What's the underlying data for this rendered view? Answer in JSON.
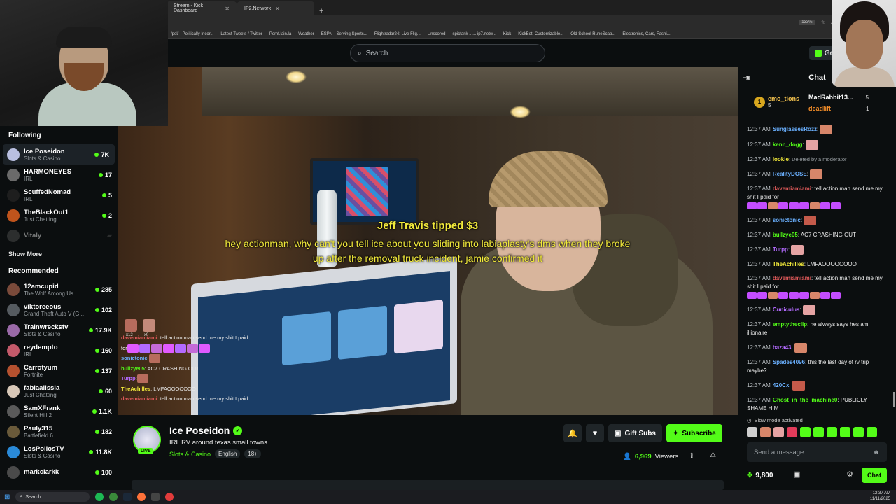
{
  "browser": {
    "tabs": [
      {
        "label": "Stream - Kick Dashboard"
      },
      {
        "label": "IP2.Network"
      }
    ],
    "zoom": "133%",
    "bookmarks": [
      "/pol/ - Politically Incor...",
      "Latest Tweets / Twitter",
      "Pomf.lain.la",
      "Weather",
      "ESPN - Serving Sports...",
      "Flightradar24: Live Flig...",
      "Unscored",
      "spictank ...... ip7.netw...",
      "Kick",
      "KickBot: Customizable...",
      "Old School RuneScap...",
      "Electronics, Cars, Fashi..."
    ]
  },
  "header": {
    "search_placeholder": "Search",
    "get_label": "Get"
  },
  "sidebar": {
    "following_title": "Following",
    "following": [
      {
        "name": "Ice Poseidon",
        "category": "Slots & Casino",
        "viewers": "7K",
        "color": "#b9bfe0"
      },
      {
        "name": "HARMONEYES",
        "category": "IRL",
        "viewers": "17",
        "color": "#6a6a6a"
      },
      {
        "name": "ScuffedNomad",
        "category": "IRL",
        "viewers": "5",
        "color": "#1e1e1e"
      },
      {
        "name": "TheBlackOut1",
        "category": "Just Chatting",
        "viewers": "2",
        "color": "#c0541c"
      },
      {
        "name": "Vitaly",
        "category": "",
        "viewers": "",
        "color": "#555555"
      }
    ],
    "show_more": "Show More",
    "recommended_title": "Recommended",
    "recommended": [
      {
        "name": "12amcupid",
        "category": "The Wolf Among Us",
        "viewers": "285",
        "color": "#7a4a3a"
      },
      {
        "name": "viktoreeous",
        "category": "Grand Theft Auto V (G...",
        "viewers": "102",
        "color": "#555b60"
      },
      {
        "name": "Trainwreckstv",
        "category": "Slots & Casino",
        "viewers": "17.9K",
        "color": "#9a6aa8"
      },
      {
        "name": "reydempto",
        "category": "IRL",
        "viewers": "160",
        "color": "#c45a6a"
      },
      {
        "name": "Carrotyum",
        "category": "Fortnite",
        "viewers": "137",
        "color": "#b5512f"
      },
      {
        "name": "fabiaalissia",
        "category": "Just Chatting",
        "viewers": "60",
        "color": "#d8c8b8"
      },
      {
        "name": "SamXFrank",
        "category": "Silent Hill 2",
        "viewers": "1.1K",
        "color": "#5a5a5a"
      },
      {
        "name": "Pauly315",
        "category": "Battlefield 6",
        "viewers": "182",
        "color": "#6a5a3a"
      },
      {
        "name": "LosPollosTV",
        "category": "Slots & Casino",
        "viewers": "11.8K",
        "color": "#2a8ad8"
      },
      {
        "name": "markclarkk",
        "category": "",
        "viewers": "100",
        "color": "#4a4a4a"
      }
    ]
  },
  "video": {
    "tip_title": "Jeff Travis tipped $3",
    "tip_message": "hey actionman, why can't you tell ice about you sliding into labiaplasty's dms when they broke up after the removal truck incident, jamie confirmed it",
    "emote_counts": [
      "x12",
      "x9"
    ],
    "overlay_chat": [
      {
        "user": "davemiamiami",
        "text": ": tell action man send me my shit I paid",
        "color": "#e05a5a"
      },
      {
        "user": "",
        "text": "for",
        "color": "#ffffff"
      },
      {
        "user": "sonictonic",
        "text": ":",
        "color": "#6ab0ff"
      },
      {
        "user": "bullzye05",
        "text": ": AC7 CRASHING OUT",
        "color": "#53fc18"
      },
      {
        "user": "Turpp",
        "text": ":",
        "color": "#b36aff"
      },
      {
        "user": "TheAchilles",
        "text": ": LMFAOOOOOOO",
        "color": "#f2ea3b"
      },
      {
        "user": "davemiamiami",
        "text": ": tell action man send me my shit I paid",
        "color": "#e05a5a"
      }
    ]
  },
  "stream": {
    "live_label": "LIVE",
    "name": "Ice Poseidon",
    "title": "IRL RV around texas small towns",
    "category": "Slots & Casino",
    "tags": [
      "English",
      "18+"
    ],
    "gift_label": "Gift Subs",
    "subscribe_label": "Subscribe",
    "viewer_count": "6,969",
    "viewers_label": "Viewers"
  },
  "chat": {
    "title": "Chat",
    "leaderboard": [
      {
        "rank": "1",
        "name": "emo_tions",
        "score": "5",
        "color": "#f2c14e"
      },
      {
        "rank": "",
        "name": "MadRabbit13...",
        "score": "5",
        "color": "#ffffff"
      },
      {
        "rank": "",
        "name": "deadlift",
        "score": "1",
        "color": "#f28c28"
      }
    ],
    "messages": [
      {
        "time": "12:37 AM",
        "user": "SunglassesRozz",
        "color": "#6ab0ff",
        "text": ":"
      },
      {
        "time": "12:37 AM",
        "user": "kenn_dogg",
        "color": "#53fc18",
        "text": ":"
      },
      {
        "time": "12:37 AM",
        "user": "lookie",
        "color": "#f2ea3b",
        "text": ": Deleted by a moderator"
      },
      {
        "time": "12:37 AM",
        "user": "RealityDOSE",
        "color": "#6ab0ff",
        "text": ":"
      },
      {
        "time": "12:37 AM",
        "user": "davemiamiami",
        "color": "#e05a5a",
        "text": ": tell action man send me my shit I paid for"
      },
      {
        "time": "12:37 AM",
        "user": "sonictonic",
        "color": "#6ab0ff",
        "text": ":"
      },
      {
        "time": "12:37 AM",
        "user": "bullzye05",
        "color": "#53fc18",
        "text": ": AC7 CRASHING OUT"
      },
      {
        "time": "12:37 AM",
        "user": "Turpp",
        "color": "#b36aff",
        "text": ":"
      },
      {
        "time": "12:37 AM",
        "user": "TheAchilles",
        "color": "#f2ea3b",
        "text": ": LMFAOOOOOOOO"
      },
      {
        "time": "12:37 AM",
        "user": "davemiamiami",
        "color": "#e05a5a",
        "text": ": tell action man send me my shit I paid for"
      },
      {
        "time": "12:37 AM",
        "user": "Cuniculus",
        "color": "#b36aff",
        "text": ":"
      },
      {
        "time": "12:37 AM",
        "user": "emptytheclip",
        "color": "#53fc18",
        "text": ": he always says hes am illionaire"
      },
      {
        "time": "12:37 AM",
        "user": "baza43",
        "color": "#b36aff",
        "text": ":"
      },
      {
        "time": "12:37 AM",
        "user": "Spades4096",
        "color": "#6ab0ff",
        "text": ": this the last day of rv trip maybe?"
      },
      {
        "time": "12:37 AM",
        "user": "420Cx",
        "color": "#6ab0ff",
        "text": ":"
      },
      {
        "time": "12:37 AM",
        "user": "Ghost_in_the_machine0",
        "color": "#53fc18",
        "text": ": PUBLICLY SHAME HIM"
      }
    ],
    "slow_mode": "Slow mode activated",
    "input_placeholder": "Send a message",
    "points": "9,800",
    "chat_button": "Chat"
  },
  "taskbar": {
    "search_label": "Search",
    "time": "12:37 AM",
    "date": "11/11/2025"
  }
}
